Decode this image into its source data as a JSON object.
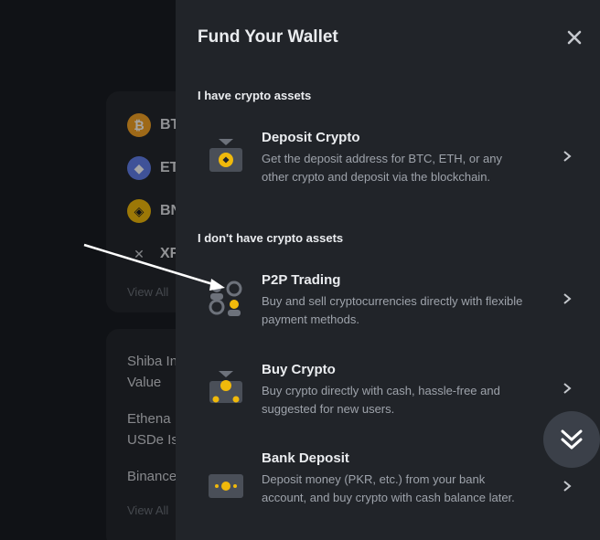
{
  "background": {
    "coins": [
      {
        "symbol": "BT",
        "icon": "btc-icon",
        "color": "#f3a226",
        "glyph": "₿"
      },
      {
        "symbol": "ET",
        "icon": "eth-icon",
        "color": "#627eea",
        "glyph": "◆"
      },
      {
        "symbol": "BN",
        "icon": "bnb-icon",
        "color": "#f0b90b",
        "glyph": "◈"
      },
      {
        "symbol": "XR",
        "icon": "xrp-icon",
        "color": "#c9ccd1",
        "glyph": "✕"
      }
    ],
    "view_all_1": "View All",
    "list_items": [
      "Shiba In",
      "Value",
      "Ethena",
      "USDe Is",
      "Binance"
    ],
    "view_all_2": "View All"
  },
  "panel": {
    "title": "Fund Your Wallet",
    "close_icon": "close-icon",
    "section_have": "I have crypto assets",
    "section_dont": "I don't have crypto assets",
    "options": [
      {
        "title": "Deposit Crypto",
        "desc": "Get the deposit address for BTC, ETH, or any other crypto and deposit via the blockchain.",
        "icon": "deposit-crypto-icon"
      },
      {
        "title": "P2P Trading",
        "desc": "Buy and sell cryptocurrencies directly with flexible payment methods.",
        "icon": "p2p-trading-icon"
      },
      {
        "title": "Buy Crypto",
        "desc": "Buy crypto directly with cash, hassle-free and suggested for new users.",
        "icon": "buy-crypto-icon"
      },
      {
        "title": "Bank Deposit",
        "desc": "Deposit money (PKR, etc.) from your bank account, and buy crypto with cash balance later.",
        "icon": "bank-deposit-icon"
      }
    ]
  },
  "colors": {
    "accent": "#f0b90b",
    "panel_bg": "#212429",
    "text_primary": "#eaecef",
    "text_secondary": "#9ea3ab"
  },
  "scroll_button_icon": "double-chevron-down-icon"
}
